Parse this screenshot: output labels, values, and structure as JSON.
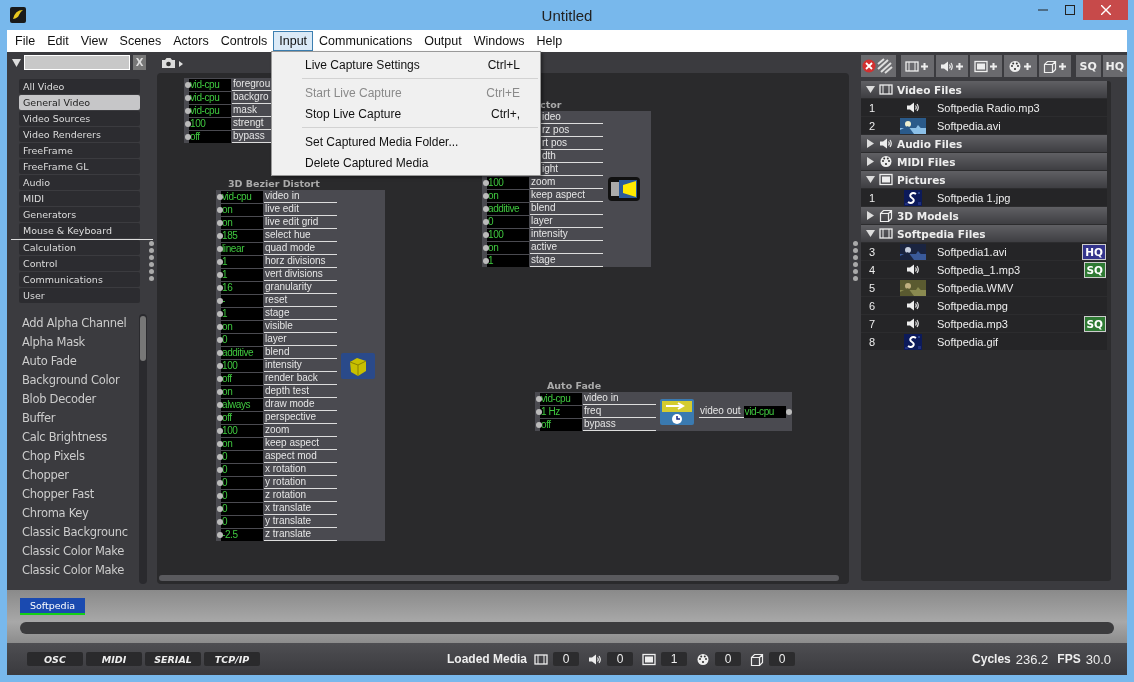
{
  "window": {
    "title": "Untitled"
  },
  "menu_bar": [
    {
      "label": "File",
      "selected": false
    },
    {
      "label": "Edit",
      "selected": false
    },
    {
      "label": "View",
      "selected": false
    },
    {
      "label": "Scenes",
      "selected": false
    },
    {
      "label": "Actors",
      "selected": false
    },
    {
      "label": "Controls",
      "selected": false
    },
    {
      "label": "Input",
      "selected": true
    },
    {
      "label": "Communications",
      "selected": false
    },
    {
      "label": "Output",
      "selected": false
    },
    {
      "label": "Windows",
      "selected": false
    },
    {
      "label": "Help",
      "selected": false
    }
  ],
  "open_menu": {
    "items": [
      {
        "kind": "item",
        "label": "Live Capture Settings",
        "shortcut": "Ctrl+L",
        "disabled": false
      },
      {
        "kind": "separator"
      },
      {
        "kind": "item",
        "label": "Start Live Capture",
        "shortcut": "Ctrl+E",
        "disabled": true
      },
      {
        "kind": "item",
        "label": "Stop Live Capture",
        "shortcut": "Ctrl+,",
        "disabled": false
      },
      {
        "kind": "separator"
      },
      {
        "kind": "item",
        "label": "Set Captured Media Folder...",
        "disabled": false
      },
      {
        "kind": "item",
        "label": "Delete Captured Media",
        "disabled": false
      }
    ]
  },
  "library": {
    "clear_label": "X",
    "video_categories": [
      {
        "label": "All Video",
        "selected": false
      },
      {
        "label": "General Video",
        "selected": true
      },
      {
        "label": "Video Sources",
        "selected": false
      },
      {
        "label": "Video Renderers",
        "selected": false
      },
      {
        "label": "FreeFrame",
        "selected": false
      },
      {
        "label": "FreeFrame GL",
        "selected": false
      },
      {
        "label": "Audio",
        "selected": false
      },
      {
        "label": "MIDI",
        "selected": false
      },
      {
        "label": "Generators",
        "selected": false
      },
      {
        "label": "Mouse & Keyboard",
        "selected": false
      }
    ],
    "other_categories": [
      {
        "label": "Calculation",
        "selected": false
      },
      {
        "label": "Control",
        "selected": false
      },
      {
        "label": "Communications",
        "selected": false
      },
      {
        "label": "User",
        "selected": false
      }
    ],
    "actors": [
      "Add Alpha Channel",
      "Alpha Mask",
      "Auto Fade",
      "Background Color",
      "Blob Decoder",
      "Buffer",
      "Calc Brightness",
      "Chop Pixels",
      "Chopper",
      "Chopper Fast",
      "Chroma Key",
      "Classic Backgrounc",
      "Classic Color Make",
      "Classic Color Make"
    ]
  },
  "canvas": {
    "nodes": [
      {
        "inputs": [
          {
            "value": "vid-cpu",
            "label": "foregrou"
          },
          {
            "value": "vid-cpu",
            "label": "backgro"
          },
          {
            "value": "vid-cpu",
            "label": "mask"
          },
          {
            "value": "100",
            "label": "strengt"
          },
          {
            "value": "off",
            "label": "bypass"
          }
        ]
      },
      {
        "title": "3D Bezier Distort",
        "inputs": [
          {
            "value": "vid-cpu",
            "label": "video in"
          },
          {
            "value": "on",
            "label": "live edit"
          },
          {
            "value": "on",
            "label": "live edit grid"
          },
          {
            "value": "185",
            "label": "select hue"
          },
          {
            "value": "linear",
            "label": "quad mode"
          },
          {
            "value": "1",
            "label": "horz divisions"
          },
          {
            "value": "1",
            "label": "vert divisions"
          },
          {
            "value": "16",
            "label": "granularity"
          },
          {
            "value": "-",
            "label": "reset"
          },
          {
            "value": "1",
            "label": "stage"
          },
          {
            "value": "on",
            "label": "visible"
          },
          {
            "value": "0",
            "label": "layer"
          },
          {
            "value": "additive",
            "label": "blend"
          },
          {
            "value": "100",
            "label": "intensity"
          },
          {
            "value": "off",
            "label": "render back"
          },
          {
            "value": "on",
            "label": "depth test"
          },
          {
            "value": "always",
            "label": "draw mode"
          },
          {
            "value": "off",
            "label": "perspective"
          },
          {
            "value": "100",
            "label": "zoom"
          },
          {
            "value": "on",
            "label": "keep aspect"
          },
          {
            "value": "0",
            "label": "aspect mod"
          },
          {
            "value": "0",
            "label": "x rotation"
          },
          {
            "value": "0",
            "label": "y rotation"
          },
          {
            "value": "0",
            "label": "z rotation"
          },
          {
            "value": "0",
            "label": "x translate"
          },
          {
            "value": "0",
            "label": "y translate"
          },
          {
            "value": "-2.5",
            "label": "z translate"
          }
        ]
      },
      {
        "title": "ctor",
        "inputs": [
          {
            "label": "ideo"
          },
          {
            "label": "rz pos"
          },
          {
            "label": "rt pos"
          },
          {
            "label": "dth"
          },
          {
            "label": "ight"
          },
          {
            "value": "100",
            "label": "zoom"
          },
          {
            "value": "on",
            "label": "keep aspect"
          },
          {
            "value": "additive",
            "label": "blend"
          },
          {
            "value": "0",
            "label": "layer"
          },
          {
            "value": "100",
            "label": "intensity"
          },
          {
            "value": "on",
            "label": "active"
          },
          {
            "value": "1",
            "label": "stage"
          }
        ]
      },
      {
        "title": "Auto Fade",
        "inputs": [
          {
            "value": "vid-cpu",
            "label": "video in"
          },
          {
            "value": "1 Hz",
            "label": "freq"
          },
          {
            "value": "off",
            "label": "bypass"
          }
        ],
        "outputs": [
          {
            "label": "video out",
            "value": "vid-cpu"
          }
        ]
      }
    ]
  },
  "media_panel": {
    "toolbar_buttons": [
      "SQ",
      "HQ"
    ],
    "sections": [
      {
        "title": "Video Files",
        "kind": "video",
        "expanded": true,
        "items": [
          {
            "number": "1",
            "kind": "audio",
            "name": "Softpedia Radio.mp3"
          },
          {
            "number": "2",
            "kind": "video",
            "name": "Softpedia.avi"
          }
        ]
      },
      {
        "title": "Audio Files",
        "kind": "audio",
        "expanded": false
      },
      {
        "title": "MIDI Files",
        "kind": "midi",
        "expanded": false
      },
      {
        "title": "Pictures",
        "kind": "picture",
        "expanded": true,
        "items": [
          {
            "number": "1",
            "name": "Softpedia 1.jpg"
          }
        ]
      },
      {
        "title": "3D Models",
        "kind": "model",
        "expanded": false
      },
      {
        "title": "Softpedia Files",
        "kind": "video",
        "expanded": true,
        "items": [
          {
            "number": "3",
            "kind": "video",
            "name": "Softpedia1.avi",
            "badge": {
              "label": "HQ",
              "color": "#34348c"
            }
          },
          {
            "number": "4",
            "kind": "audio",
            "name": "Softpedia_1.mp3",
            "badge": {
              "label": "SQ",
              "color": "#2f7a34"
            }
          },
          {
            "number": "5",
            "kind": "video",
            "name": "Softpedia.WMV"
          },
          {
            "number": "6",
            "kind": "audio",
            "name": "Softpedia.mpg"
          },
          {
            "number": "7",
            "kind": "audio",
            "name": "Softpedia.mp3",
            "badge": {
              "label": "SQ",
              "color": "#2f7a34"
            }
          },
          {
            "number": "8",
            "name": "Softpedia.gif"
          }
        ]
      }
    ]
  },
  "stage_tabs": [
    {
      "label": "Softpedia",
      "selected": true
    }
  ],
  "status_bar": {
    "protocol_buttons": [
      "OSC",
      "MIDI",
      "SERIAL",
      "TCP/IP"
    ],
    "loaded_media_label": "Loaded Media",
    "counts": [
      {
        "kind": "video",
        "value": "0"
      },
      {
        "kind": "audio",
        "value": "0"
      },
      {
        "kind": "picture",
        "value": "1"
      },
      {
        "kind": "midi",
        "value": "0"
      },
      {
        "kind": "model",
        "value": "0"
      }
    ],
    "stats": [
      {
        "label": "Cycles",
        "value": "236.2"
      },
      {
        "label": "FPS",
        "value": "30.0"
      }
    ]
  }
}
